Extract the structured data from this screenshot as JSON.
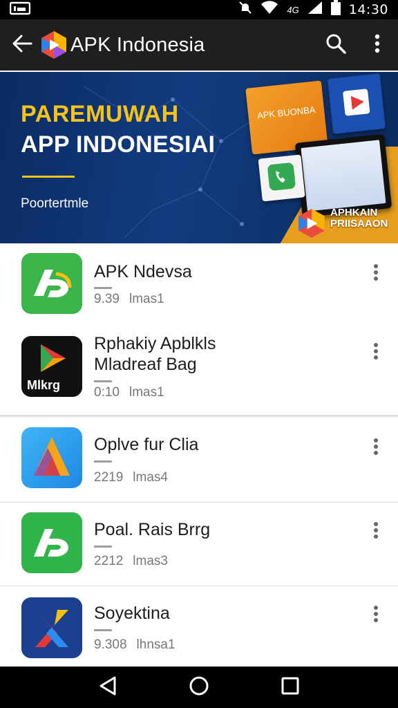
{
  "status_bar": {
    "time": "14:30",
    "network": "4G",
    "icons": [
      "photo-notification-icon",
      "mute-icon",
      "wifi-icon",
      "signal-icon",
      "battery-icon"
    ]
  },
  "app_bar": {
    "title": "APK Indonesia",
    "icons": [
      "back-arrow-icon",
      "app-logo-icon",
      "search-icon",
      "more-vert-icon"
    ]
  },
  "banner": {
    "heading_line1": "PAREMUWAH",
    "heading_line2": "APP INDONESIAI",
    "subtitle": "Poortertmle",
    "card_text": "APK BUONBA",
    "brand_text": "APHKAIN PRIISAAON",
    "colors": {
      "heading_accent": "#f5c41c",
      "background": "#123c80",
      "stripe": "#f2a41a"
    }
  },
  "apps": [
    {
      "name": "APK Ndevsa",
      "size": "9.39",
      "info": "lmas1",
      "icon": "green-ad-app-icon"
    },
    {
      "name": "Rphakiy Apblkls Mladreaf Bag",
      "size": "0:10",
      "info": "lmas1",
      "icon": "play-triangle-app-icon",
      "icon_label": "Mlkrg"
    },
    {
      "name": "Oplve fur Clia",
      "size": "2219",
      "info": "lmas4",
      "icon": "blue-a-app-icon"
    },
    {
      "name": "Poal. Rais Brrg",
      "size": "2212",
      "info": "lmas3",
      "icon": "green-ad-app-icon"
    },
    {
      "name": "Soyektina",
      "size": "9.308",
      "info": "lhnsa1",
      "icon": "x-logo-app-icon"
    }
  ],
  "nav_bar": {
    "icons": [
      "nav-back-icon",
      "nav-home-icon",
      "nav-recents-icon"
    ]
  }
}
